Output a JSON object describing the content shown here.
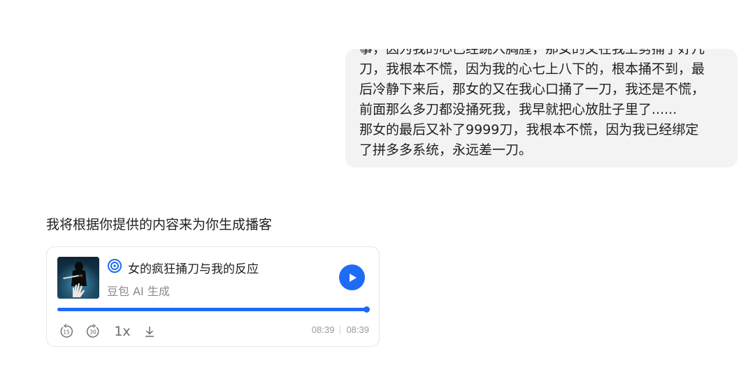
{
  "user_message": {
    "lines": [
      "事，因为我的心已经跳入胸膛，那女的又在我上劈捅了好几",
      "刀，我根本不慌，因为我的心七上八下的，根本捅不到，最",
      "后冷静下来后，那女的又在我心口捅了一刀，我还是不慌，",
      "前面那么多刀都没捅死我，我早就把心放肚子里了......",
      "那女的最后又补了9999刀，我根本不慌，因为我已经绑定",
      "了拼多多系统，永远差一刀。"
    ]
  },
  "assistant": {
    "reply": "我将根据你提供的内容来为你生成播客",
    "podcast": {
      "title": "女的疯狂捅刀与我的反应",
      "subtitle": "豆包 AI 生成",
      "progress": 1.0,
      "speed_label": "1x",
      "current_time": "08:39",
      "total_time": "08:39",
      "rewind_seconds": "15",
      "forward_seconds": "30",
      "accent_color": "#1f6bf5"
    }
  }
}
